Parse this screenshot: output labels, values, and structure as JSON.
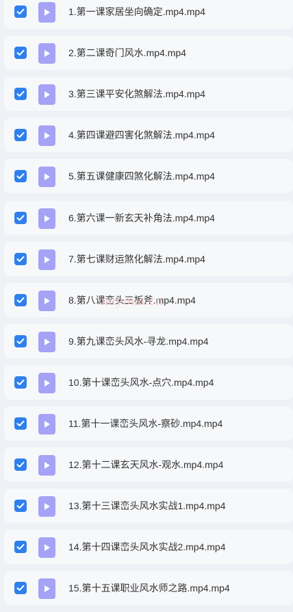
{
  "files": [
    {
      "name": "1.第一课家居坐向确定.mp4.mp4",
      "checked": true
    },
    {
      "name": "2.第二课奇门风水.mp4.mp4",
      "checked": true
    },
    {
      "name": "3.第三课平安化煞解法.mp4.mp4",
      "checked": true
    },
    {
      "name": "4.第四课避四害化煞解法.mp4.mp4",
      "checked": true
    },
    {
      "name": "5.第五课健康四煞化解法.mp4.mp4",
      "checked": true
    },
    {
      "name": "6.第六课一新玄天补角法.mp4.mp4",
      "checked": true
    },
    {
      "name": "7.第七课财运煞化解法.mp4.mp4",
      "checked": true
    },
    {
      "name": "8.第八课峦头三板斧.mp4.mp4",
      "checked": true
    },
    {
      "name": "9.第九课峦头风水-寻龙.mp4.mp4",
      "checked": true
    },
    {
      "name": "10.第十课峦头风水-点穴.mp4.mp4",
      "checked": true
    },
    {
      "name": "11.第十一课峦头风水-察砂.mp4.mp4",
      "checked": true
    },
    {
      "name": "12.第十二课玄天风水-观水.mp4.mp4",
      "checked": true
    },
    {
      "name": "13.第十三课峦头风水实战1.mp4.mp4",
      "checked": true
    },
    {
      "name": "14.第十四课峦头风水实战2.mp4.mp4",
      "checked": true
    },
    {
      "name": "15.第十五课职业风水师之路.mp4.mp4",
      "checked": true
    }
  ],
  "watermark": "nayona.cn",
  "colors": {
    "checkbox": "#2f80ed",
    "file_icon": "#a6a2f5",
    "row_background": "#f7f8fa",
    "page_background": "#eef1f6",
    "text": "#333333"
  },
  "icons": {
    "checkbox": "checkmark-icon",
    "file": "video-play-icon"
  }
}
